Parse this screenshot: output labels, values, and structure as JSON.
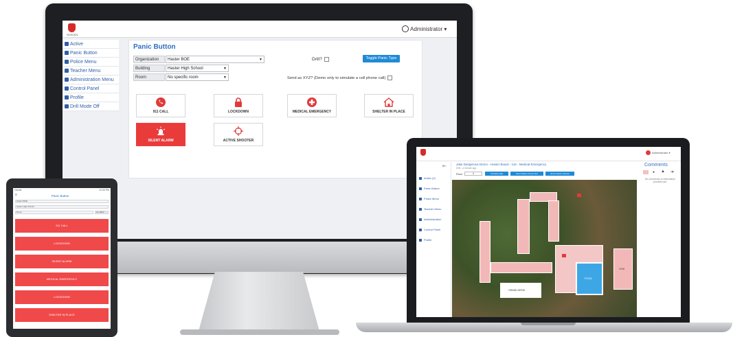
{
  "imac": {
    "user_menu": "Administrator ▾",
    "logo_text": "SCHOOL",
    "sidebar": [
      {
        "label": "Active",
        "icon": "flag-icon"
      },
      {
        "label": "Panic Button",
        "icon": "warning-icon"
      },
      {
        "label": "Police Menu",
        "icon": "gear-icon"
      },
      {
        "label": "Teacher Menu",
        "icon": "building-icon"
      },
      {
        "label": "Administration Menu",
        "icon": "wrench-icon"
      },
      {
        "label": "Control Panel",
        "icon": "bank-icon"
      },
      {
        "label": "Profile",
        "icon": "user-icon"
      },
      {
        "label": "Drill Mode Off",
        "icon": "warning-icon"
      }
    ],
    "panel_title": "Panic Button",
    "form": {
      "organization_label": "Organization",
      "organization_value": "Haster BOE",
      "building_label": "Building",
      "building_value": "Haster High School",
      "room_label": "Room",
      "room_value": "No specific room"
    },
    "drill_label": "Drill?",
    "toggle_button": "Toggle Panic Type",
    "send_as_label": "Send as XYZ? (Demo only to simulate a cell phone call)",
    "panic_buttons": [
      {
        "label": "911 CALL",
        "icon": "phone-icon",
        "style": "white"
      },
      {
        "label": "LOCKDOWN",
        "icon": "lock-icon",
        "style": "white"
      },
      {
        "label": "MEDICAL EMERGENCY",
        "icon": "medical-cross-icon",
        "style": "white"
      },
      {
        "label": "SHELTER IN PLACE",
        "icon": "house-icon",
        "style": "white"
      },
      {
        "label": "SILENT ALARM",
        "icon": "siren-icon",
        "style": "red"
      },
      {
        "label": "ACTIVE SHOOTER",
        "icon": "crosshair-icon",
        "style": "white"
      }
    ]
  },
  "tablet": {
    "status_left": "Carrier",
    "status_right": "12:00 PM",
    "title": "Panic Button",
    "field1": "Haster BOE",
    "field2": "Haster High School",
    "field3": "Room",
    "go_button": "Go Back",
    "buttons": [
      "911 CALL",
      "LOCKDOWN",
      "SILENT ALARM",
      "MEDICAL EMERGENCY",
      "LOCKDOWN",
      "SHELTER IN PLACE"
    ]
  },
  "laptop": {
    "user_menu": "Administrator ▾",
    "header_title": "Jake Dangerous Demo - Haster Board - 115 - Medical Emergency",
    "header_sub": "Drill - a minute ago",
    "floor_label": "Floor",
    "floor_value": "1",
    "buttons": [
      "Printable Map",
      "Send Status Check Text",
      "Show Status Checks"
    ],
    "sidebar": [
      {
        "label": "Active (2)",
        "icon": "flag-icon"
      },
      {
        "label": "Panic Button",
        "icon": "warning-icon"
      },
      {
        "label": "Police Menu",
        "icon": "gear-icon"
      },
      {
        "label": "Teacher Menu",
        "icon": "building-icon"
      },
      {
        "label": "Administration",
        "icon": "wrench-icon"
      },
      {
        "label": "Control Panel",
        "icon": "bank-icon"
      },
      {
        "label": "Profile",
        "icon": "user-icon"
      }
    ],
    "comments_title": "Comments",
    "comments_text": "No comments or information provided yet.",
    "map_labels": [
      "GRAND DRIVE",
      "GYM",
      "POOL"
    ],
    "colors": {
      "accent": "#1f8ad6",
      "alert": "#ea3b3b",
      "link": "#2f6fbf"
    }
  }
}
